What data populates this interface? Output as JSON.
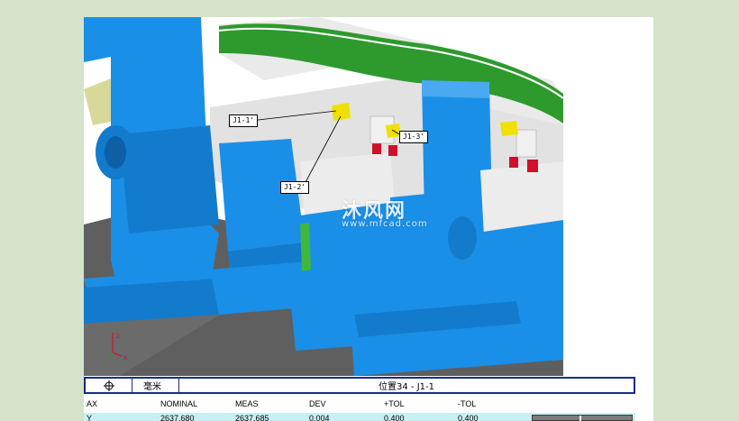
{
  "callouts": {
    "j1_1": "J1-1'",
    "j1_2": "J1-2'",
    "j1_3": "J1-3'"
  },
  "watermark": {
    "main": "沐风网",
    "sub": "www.mfcad.com"
  },
  "axis_triad": {
    "icon": "xyz-axis-triad-icon"
  },
  "table": {
    "header": {
      "icon": "crosshair-icon",
      "units": "毫米",
      "position_label": "位置34 - J1-1"
    },
    "columns": [
      "AX",
      "NOMINAL",
      "MEAS",
      "DEV",
      "+TOL",
      "-TOL"
    ],
    "rows": [
      {
        "ax": "Y",
        "nominal": "2637.680",
        "meas": "2637.685",
        "dev": "0.004",
        "plus_tol": "0.400",
        "minus_tol": "0.400"
      }
    ]
  },
  "colors": {
    "fixture_blue": "#1a8fe8",
    "panel_gray": "#e4e4e4",
    "base_plate": "#5e5e5e",
    "sheet_green": "#2e8b2e",
    "sensor_yellow": "#f0e000",
    "table_border": "#1a2a8a",
    "row_highlight": "#c8f0f4",
    "page_bg": "#d4e3c9"
  }
}
